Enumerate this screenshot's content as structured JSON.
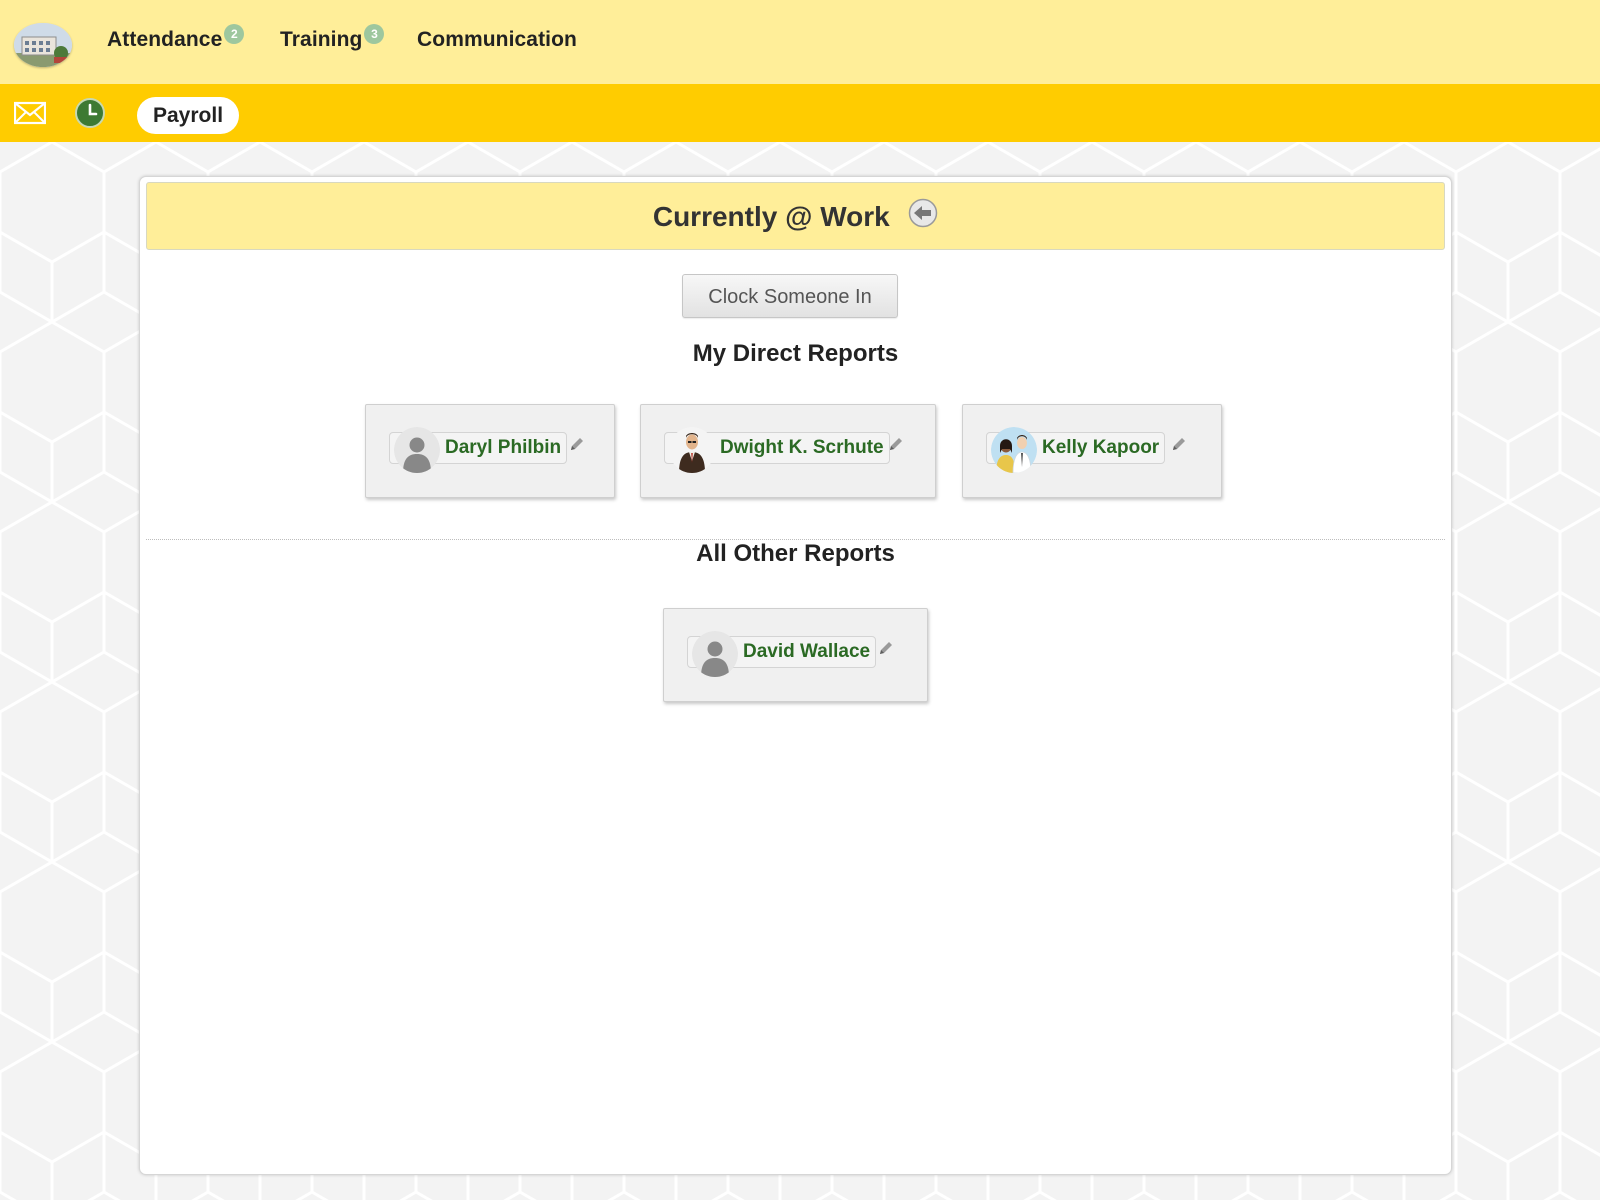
{
  "nav": {
    "items": [
      {
        "label": "Attendance",
        "badge": "2"
      },
      {
        "label": "Training",
        "badge": "3"
      },
      {
        "label": "Communication"
      }
    ]
  },
  "subnav": {
    "payroll_label": "Payroll",
    "icons": [
      "mail-icon",
      "clock-icon"
    ]
  },
  "panel": {
    "title": "Currently @ Work",
    "clock_in_label": "Clock Someone In",
    "direct_reports_title": "My Direct Reports",
    "other_reports_title": "All Other Reports",
    "direct_reports": [
      {
        "name": "Daryl Philbin",
        "avatar": "generic-person"
      },
      {
        "name": "Dwight K. Scrhute",
        "avatar": "portrait-man"
      },
      {
        "name": "Kelly Kapoor",
        "avatar": "couple"
      }
    ],
    "other_reports": [
      {
        "name": "David Wallace",
        "avatar": "generic-person"
      }
    ]
  },
  "colors": {
    "top_nav": "#ffee99",
    "sub_nav": "#ffcc00",
    "employee_name": "#2b6a24",
    "badge": "#9ec79e",
    "clock_icon": "#3d7a33"
  }
}
